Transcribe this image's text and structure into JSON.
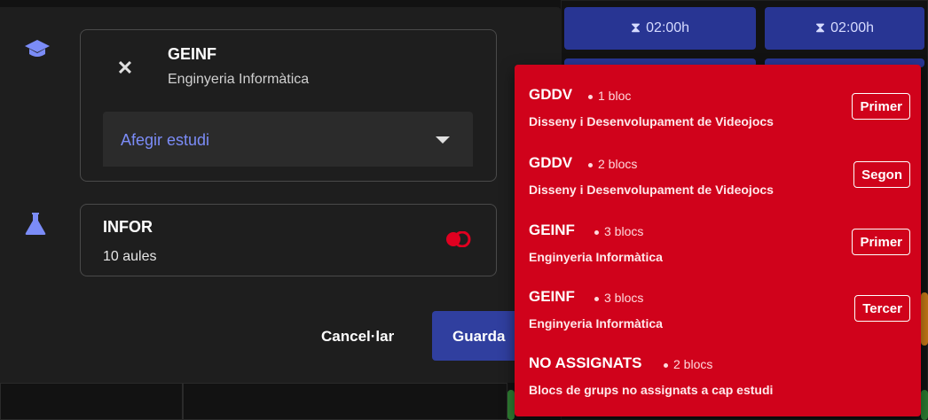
{
  "background": {
    "cards": [
      {
        "time": "02:00h"
      },
      {
        "time": "02:00h"
      }
    ]
  },
  "dialog": {
    "studies": {
      "item": {
        "code": "GEINF",
        "name": "Enginyeria Informàtica"
      },
      "add_select_label": "Afegir estudi"
    },
    "rooms": {
      "code": "INFOR",
      "count": "10 aules"
    },
    "actions": {
      "cancel": "Cancel·lar",
      "save": "Guarda"
    }
  },
  "menu": {
    "items": [
      {
        "code": "GDDV",
        "count": "1 bloc",
        "desc": "Disseny i Desenvolupament de Videojocs",
        "chip": "Primer"
      },
      {
        "code": "GDDV",
        "count": "2 blocs",
        "desc": "Disseny i Desenvolupament de Videojocs",
        "chip": "Segon"
      },
      {
        "code": "GEINF",
        "count": "3 blocs",
        "desc": "Enginyeria Informàtica",
        "chip": "Primer"
      },
      {
        "code": "GEINF",
        "count": "3 blocs",
        "desc": "Enginyeria Informàtica",
        "chip": "Tercer"
      },
      {
        "code": "NO ASSIGNATS",
        "count": "2 blocs",
        "desc": "Blocs de grups no assignats a cap estudi",
        "chip": ""
      }
    ]
  },
  "colors": {
    "accent": "#303f9f",
    "menu_bg": "#d0021b",
    "icon_blue": "#7b8cf7"
  }
}
